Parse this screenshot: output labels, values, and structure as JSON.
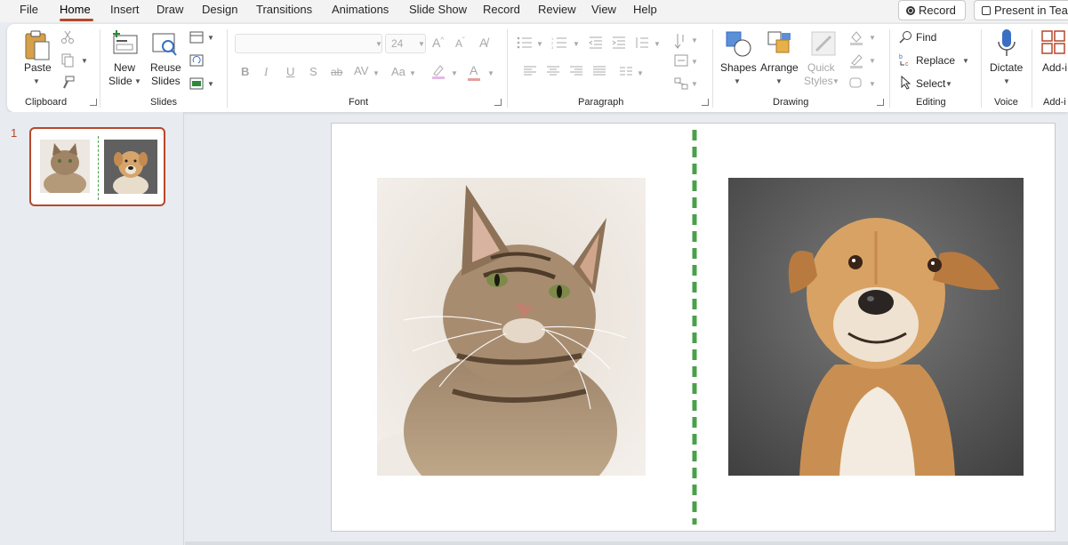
{
  "menu": {
    "tabs": [
      "File",
      "Home",
      "Insert",
      "Draw",
      "Design",
      "Transitions",
      "Animations",
      "Slide Show",
      "Record",
      "Review",
      "View",
      "Help"
    ],
    "active_tab": "Home",
    "record_button": "Record",
    "present_button": "Present in Tea"
  },
  "ribbon": {
    "clipboard": {
      "label": "Clipboard",
      "paste": "Paste"
    },
    "slides": {
      "label": "Slides",
      "new_slide_1": "New",
      "new_slide_2": "Slide",
      "reuse_1": "Reuse",
      "reuse_2": "Slides"
    },
    "font": {
      "label": "Font",
      "font_name": "",
      "font_size": "24"
    },
    "paragraph": {
      "label": "Paragraph"
    },
    "drawing": {
      "label": "Drawing",
      "shapes": "Shapes",
      "arrange": "Arrange",
      "quick_1": "Quick",
      "quick_2": "Styles"
    },
    "editing": {
      "label": "Editing",
      "find": "Find",
      "replace": "Replace",
      "select": "Select"
    },
    "voice": {
      "label": "Voice",
      "dictate": "Dictate"
    },
    "addins": {
      "label": "Add-i",
      "addins_btn": "Add-i"
    }
  },
  "slide_panel": {
    "slide_number": "1"
  },
  "slide": {
    "left_image": "tabby-cat-photo",
    "right_image": "dog-portrait-photo",
    "divider_color": "#4aa04a"
  },
  "colors": {
    "accent": "#b7472a",
    "divider": "#4aa04a"
  }
}
